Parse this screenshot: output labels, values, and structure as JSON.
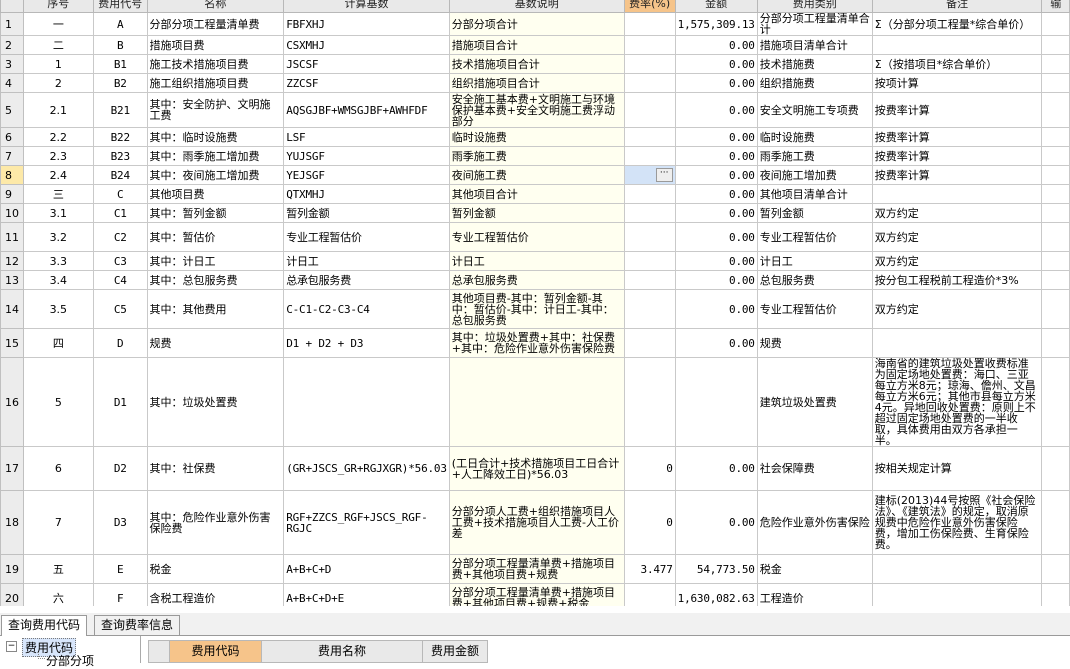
{
  "columns": [
    "序号",
    "费用代号",
    "名称",
    "计算基数",
    "基数说明",
    "费率(%)",
    "金额",
    "费用类别",
    "备注",
    "输"
  ],
  "rows": [
    {
      "n": "1",
      "seq": "一",
      "code": "A",
      "name": "分部分项工程量清单费",
      "base": "FBFXHJ",
      "desc": "分部分项合计",
      "rate": "",
      "amount": "1,575,309.13",
      "cat": "分部分项工程量清单合计",
      "note": "Σ（分部分项工程量*综合单价）"
    },
    {
      "n": "2",
      "seq": "二",
      "code": "B",
      "name": "措施项目费",
      "base": "CSXMHJ",
      "desc": "措施项目合计",
      "rate": "",
      "amount": "0.00",
      "cat": "措施项目清单合计",
      "note": ""
    },
    {
      "n": "3",
      "seq": "1",
      "code": "B1",
      "name": "施工技术措施项目费",
      "base": "JSCSF",
      "desc": "技术措施项目合计",
      "rate": "",
      "amount": "0.00",
      "cat": "技术措施费",
      "note": "Σ（按措项目*综合单价）"
    },
    {
      "n": "4",
      "seq": "2",
      "code": "B2",
      "name": "施工组织措施项目费",
      "base": "ZZCSF",
      "desc": "组织措施项目合计",
      "rate": "",
      "amount": "0.00",
      "cat": "组织措施费",
      "note": "按项计算"
    },
    {
      "n": "5",
      "seq": "2.1",
      "code": "B21",
      "name": "其中：安全防护、文明施工费",
      "base": "AQSGJBF+WMSGJBF+AWHFDF",
      "desc": "安全施工基本费+文明施工与环境保护基本费+安全文明施工费浮动部分",
      "rate": "",
      "amount": "0.00",
      "cat": "安全文明施工专项费",
      "note": "按费率计算"
    },
    {
      "n": "6",
      "seq": "2.2",
      "code": "B22",
      "name": "其中：临时设施费",
      "base": "LSF",
      "desc": "临时设施费",
      "rate": "",
      "amount": "0.00",
      "cat": "临时设施费",
      "note": "按费率计算"
    },
    {
      "n": "7",
      "seq": "2.3",
      "code": "B23",
      "name": "其中：雨季施工增加费",
      "base": "YUJSGF",
      "desc": "雨季施工费",
      "rate": "",
      "amount": "0.00",
      "cat": "雨季施工费",
      "note": "按费率计算"
    },
    {
      "n": "8",
      "seq": "2.4",
      "code": "B24",
      "name": "其中：夜间施工增加费",
      "base": "YEJSGF",
      "desc": "夜间施工费",
      "rate": "",
      "amount": "0.00",
      "cat": "夜间施工增加费",
      "note": "按费率计算"
    },
    {
      "n": "9",
      "seq": "三",
      "code": "C",
      "name": "其他项目费",
      "base": "QTXMHJ",
      "desc": "其他项目合计",
      "rate": "",
      "amount": "0.00",
      "cat": "其他项目清单合计",
      "note": ""
    },
    {
      "n": "10",
      "seq": "3.1",
      "code": "C1",
      "name": "其中：暂列金额",
      "base": "暂列金额",
      "desc": "暂列金额",
      "rate": "",
      "amount": "0.00",
      "cat": "暂列金额",
      "note": "双方约定"
    },
    {
      "n": "11",
      "seq": "3.2",
      "code": "C2",
      "name": "其中：暂估价",
      "base": "专业工程暂估价",
      "desc": "专业工程暂估价",
      "rate": "",
      "amount": "0.00",
      "cat": "专业工程暂估价",
      "note": "双方约定"
    },
    {
      "n": "12",
      "seq": "3.3",
      "code": "C3",
      "name": "其中：计日工",
      "base": "计日工",
      "desc": "计日工",
      "rate": "",
      "amount": "0.00",
      "cat": "计日工",
      "note": "双方约定"
    },
    {
      "n": "13",
      "seq": "3.4",
      "code": "C4",
      "name": "其中：总包服务费",
      "base": "总承包服务费",
      "desc": "总承包服务费",
      "rate": "",
      "amount": "0.00",
      "cat": "总包服务费",
      "note": "按分包工程税前工程造价*3%"
    },
    {
      "n": "14",
      "seq": "3.5",
      "code": "C5",
      "name": "其中：其他费用",
      "base": "C-C1-C2-C3-C4",
      "desc": "其他项目费-其中：暂列金额-其中：暂估价-其中：计日工-其中：总包服务费",
      "rate": "",
      "amount": "0.00",
      "cat": "专业工程暂估价",
      "note": "双方约定"
    },
    {
      "n": "15",
      "seq": "四",
      "code": "D",
      "name": "规费",
      "base": "D1 + D2 + D3",
      "desc": "其中：垃圾处置费+其中：社保费+其中：危险作业意外伤害保险费",
      "rate": "",
      "amount": "0.00",
      "cat": "规费",
      "note": ""
    },
    {
      "n": "16",
      "seq": "5",
      "code": "D1",
      "name": "其中：垃圾处置费",
      "base": "",
      "desc": "",
      "rate": "",
      "amount": "",
      "cat": "建筑垃圾处置费",
      "note": "海南省的建筑垃圾处置收费标准为固定场地处置费：海口、三亚每立方米8元；琼海、儋州、文昌每立方米6元；其他市县每立方米4元。异地回收处置费：原则上不超过固定场地处置费的一半收取，具体费用由双方各承担一半。"
    },
    {
      "n": "17",
      "seq": "6",
      "code": "D2",
      "name": "其中：社保费",
      "base": "(GR+JSCS_GR+RGJXGR)*56.03",
      "desc": "(工日合计+技术措施项目工日合计+人工降效工日)*56.03",
      "rate": "0",
      "amount": "0.00",
      "cat": "社会保障费",
      "note": "按相关规定计算"
    },
    {
      "n": "18",
      "seq": "7",
      "code": "D3",
      "name": "其中：危险作业意外伤害保险费",
      "base": "RGF+ZZCS_RGF+JSCS_RGF-RGJC",
      "desc": "分部分项人工费+组织措施项目人工费+技术措施项目人工费-人工价差",
      "rate": "0",
      "amount": "0.00",
      "cat": "危险作业意外伤害保险",
      "note": "建标(2013)44号按照《社会保险法》、《建筑法》的规定，取消原规费中危险作业意外伤害保险费，增加工伤保险费、生育保险费。"
    },
    {
      "n": "19",
      "seq": "五",
      "code": "E",
      "name": "税金",
      "base": "A+B+C+D",
      "desc": "分部分项工程量清单费+措施项目费+其他项目费+规费",
      "rate": "3.477",
      "amount": "54,773.50",
      "cat": "税金",
      "note": ""
    },
    {
      "n": "20",
      "seq": "六",
      "code": "F",
      "name": "含税工程造价",
      "base": "A+B+C+D+E",
      "desc": "分部分项工程量清单费+措施项目费+其他项目费+规费+税金",
      "rate": "",
      "amount": "1,630,082.63",
      "cat": "工程造价",
      "note": ""
    }
  ],
  "tabs": [
    "查询费用代码",
    "查询费率信息"
  ],
  "tree": {
    "root": "费用代码",
    "child": "分部分项"
  },
  "sub_columns": [
    "费用代码",
    "费用名称",
    "费用金额"
  ],
  "colors": {
    "header_bg": "#e9e9e9",
    "highlight_header": "#f6c48a",
    "selected_row": "#fde9a8",
    "selected_cell": "#d3e3f7",
    "desc_bg": "#fffff0"
  }
}
